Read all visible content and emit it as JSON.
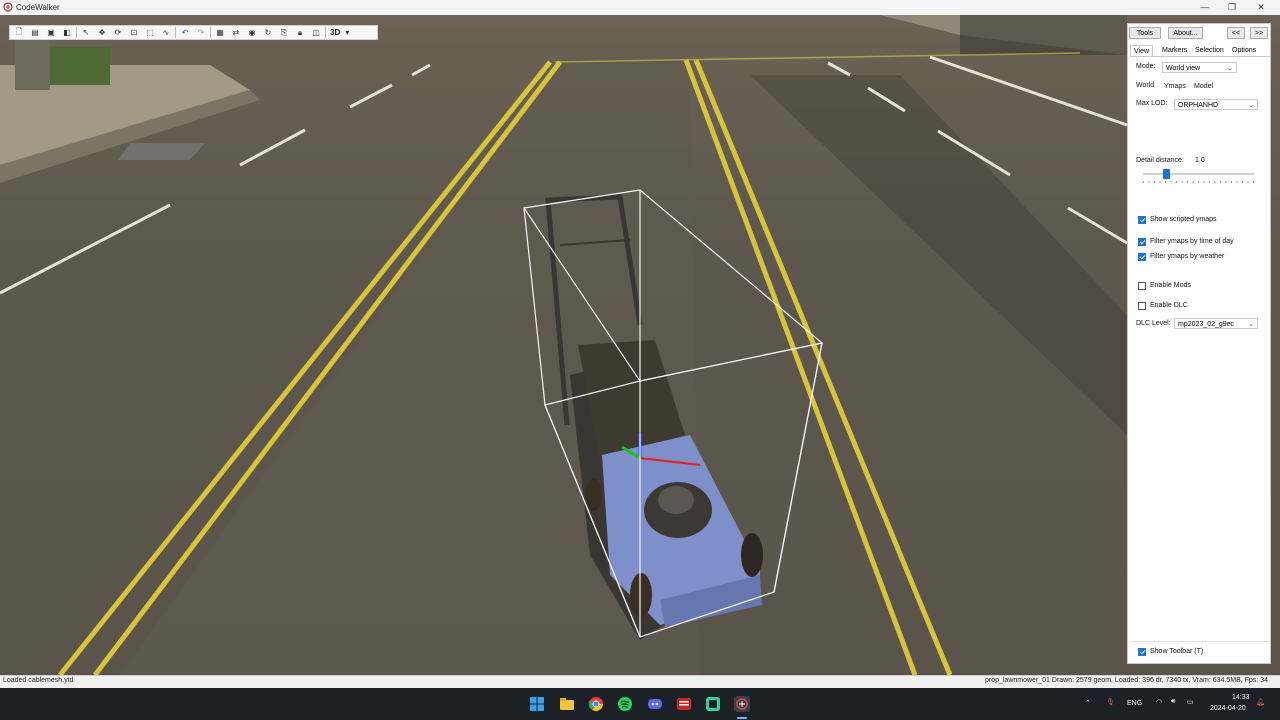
{
  "window": {
    "title": "CodeWalker",
    "controls": {
      "minimize": "—",
      "maximize": "❐",
      "close": "✕"
    }
  },
  "toolbar": {
    "view_mode_label": "3D"
  },
  "panel": {
    "top_buttons": {
      "tools": "Tools",
      "about": "About...",
      "collapse": "<<",
      "expand": ">>"
    },
    "tabs": [
      "View",
      "Markers",
      "Selection",
      "Options"
    ],
    "active_tab": "View",
    "mode_label": "Mode:",
    "mode_value": "World view",
    "subtabs": [
      "World",
      "Ymaps",
      "Model"
    ],
    "max_lod_label": "Max LOD:",
    "max_lod_value": "ORPHANHD",
    "detail_distance_label": "Detail distance:",
    "detail_distance_value": "1.0",
    "checkboxes": [
      {
        "label": "Show scripted ymaps",
        "checked": true
      },
      {
        "label": "Filter ymaps by time of day",
        "checked": true
      },
      {
        "label": "Filter ymaps by weather",
        "checked": true
      },
      {
        "label": "Enable Mods",
        "checked": false
      },
      {
        "label": "Enable DLC",
        "checked": false
      }
    ],
    "dlc_level_label": "DLC Level:",
    "dlc_level_value": "mp2023_02_g9ec",
    "show_toolbar_label": "Show Toolbar (T)",
    "show_toolbar_checked": true
  },
  "statusbar": {
    "left_text": "Loaded cablemesh.ytd",
    "right_text": "prop_lawnmower_01   Drawn: 2579 geom, Loaded: 396 dr, 7340 tx, Vram: 634.5MB, Fps: 34"
  },
  "taskbar": {
    "language": "ENG",
    "time": "14:33",
    "date": "2024-04-20",
    "apps": [
      "windows-start",
      "file-explorer",
      "chrome",
      "spotify",
      "discord",
      "media-app",
      "terminal-app",
      "codewalker"
    ]
  },
  "colors": {
    "accent": "#1a73d6",
    "road": "#5e584e",
    "lane_yellow": "#d8c43a",
    "mower_body": "#7f8fc9"
  }
}
